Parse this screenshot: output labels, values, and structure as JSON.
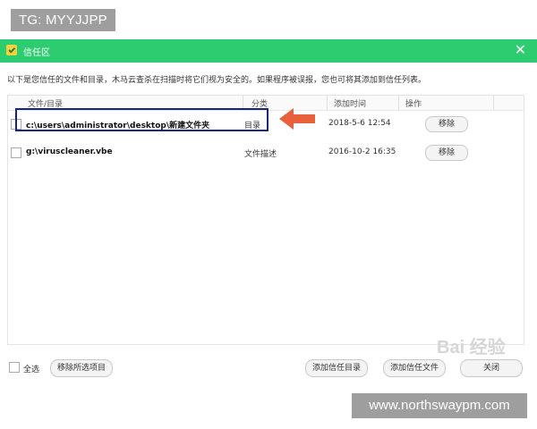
{
  "watermark_top": "TG: MYYJJPP",
  "watermark_bottom": "www.northswaypm.com",
  "watermark_baidu": "Bai 经验",
  "window": {
    "title": "信任区",
    "close_icon": "close-icon",
    "accent_color": "#2ecc71"
  },
  "description": "以下是您信任的文件和目录，木马云查杀在扫描时将它们视为安全的。如果程序被误报，您也可将其添加到信任列表。",
  "table": {
    "headers": [
      "文件/目录",
      "分类",
      "添加时间",
      "操作"
    ],
    "rows": [
      {
        "path": "c:\\users\\administrator\\desktop\\新建文件夹",
        "category": "目录",
        "time": "2018-5-6 12:54",
        "action": "移除"
      },
      {
        "path": "g:\\viruscleaner.vbe",
        "category": "文件描述",
        "time": "2016-10-2 16:35",
        "action": "移除"
      }
    ]
  },
  "annotation": {
    "highlight_color": "#1a237e",
    "arrow_color": "#e8603c"
  },
  "footer": {
    "select_all_label": "全选",
    "remove_selected_label": "移除所选项目",
    "add_trusted_dir_label": "添加信任目录",
    "add_trusted_file_label": "添加信任文件",
    "close_label": "关闭"
  }
}
